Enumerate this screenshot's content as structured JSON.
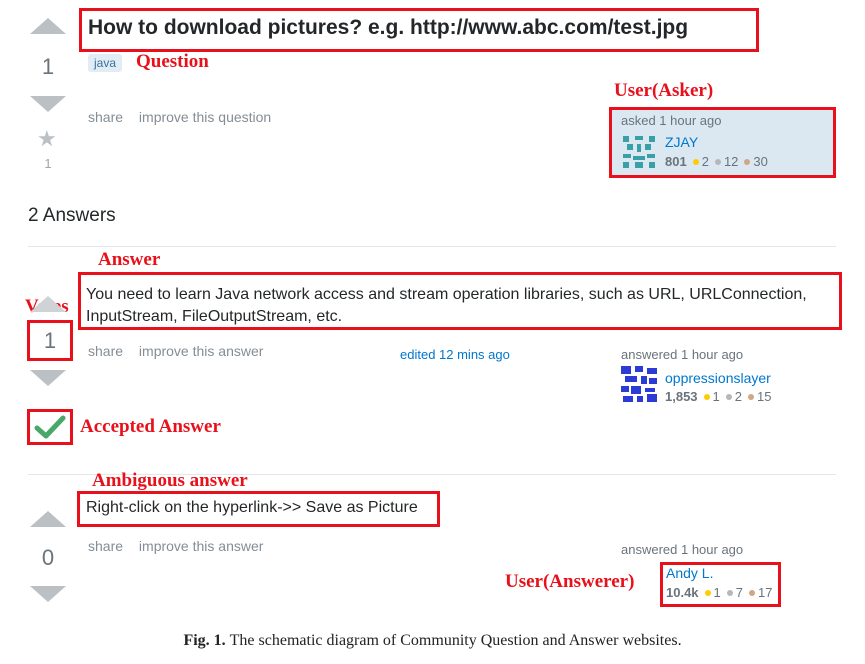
{
  "question": {
    "title": "How to download pictures? e.g. http://www.abc.com/test.jpg",
    "votes": "1",
    "tag": "java",
    "favorites": "1",
    "menu": {
      "share": "share",
      "improve": "improve this question"
    },
    "asker": {
      "action": "asked 1 hour ago",
      "name": "ZJAY",
      "reputation": "801",
      "gold": "2",
      "silver": "12",
      "bronze": "30"
    }
  },
  "answers_header": "2 Answers",
  "answers": [
    {
      "text": "You need to learn Java network access and stream operation libraries, such as URL, URLConnection, InputStream, FileOutputStream, etc.",
      "votes": "1",
      "menu": {
        "share": "share",
        "improve": "improve this answer"
      },
      "edited": "edited 12 mins ago",
      "answerer": {
        "action": "answered 1 hour ago",
        "name": "oppressionslayer",
        "reputation": "1,853",
        "gold": "1",
        "silver": "2",
        "bronze": "15"
      },
      "accepted": true
    },
    {
      "text": "Right-click on the hyperlink->> Save as Picture",
      "votes": "0",
      "menu": {
        "share": "share",
        "improve": "improve this answer"
      },
      "answerer": {
        "action": "answered 1 hour ago",
        "name": "Andy L.",
        "reputation": "10.4k",
        "gold": "1",
        "silver": "7",
        "bronze": "17"
      }
    }
  ],
  "annotations": {
    "question": "Question",
    "asker": "User(Asker)",
    "answer": "Answer",
    "votes": "Votes",
    "accepted": "Accepted Answer",
    "ambiguous": "Ambiguous answer",
    "answerer": "User(Answerer)"
  },
  "caption": {
    "label": "Fig. 1.",
    "text": "The schematic diagram of Community Question and Answer websites."
  },
  "colors": {
    "annotation_red": "#e8101a",
    "gold": "#ffcc01",
    "silver": "#b4b8bc",
    "bronze": "#d1a684",
    "link": "#0077cc",
    "accepted": "#48a868"
  }
}
